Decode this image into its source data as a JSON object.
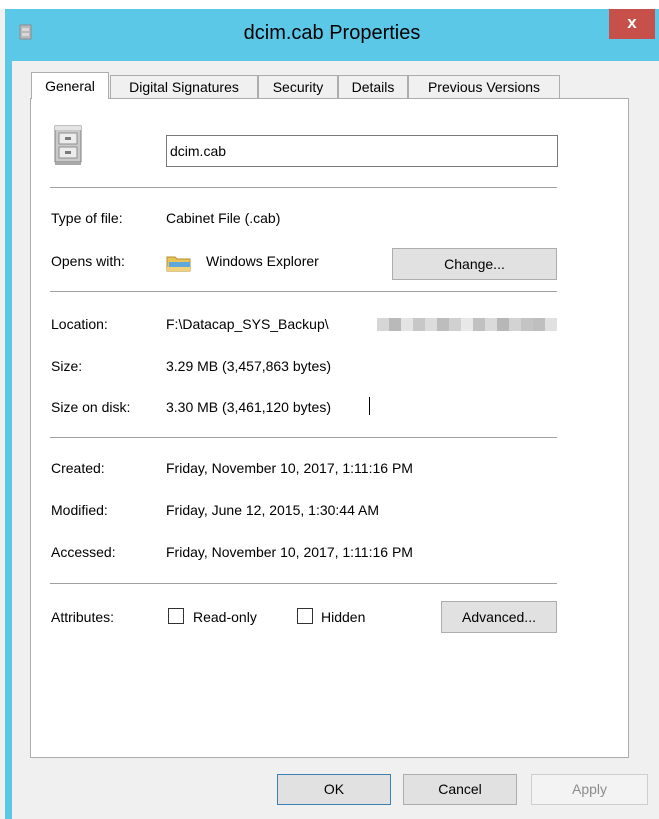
{
  "window": {
    "title": "dcim.cab Properties",
    "close_glyph": "x"
  },
  "tabs": [
    {
      "label": "General",
      "active": true
    },
    {
      "label": "Digital Signatures"
    },
    {
      "label": "Security"
    },
    {
      "label": "Details"
    },
    {
      "label": "Previous Versions"
    }
  ],
  "file": {
    "name": "dcim.cab",
    "icon": "file-cabinet-icon",
    "type_label": "Type of file:",
    "type_value": "Cabinet File (.cab)",
    "opens_label": "Opens with:",
    "opens_value": "Windows Explorer",
    "opens_icon": "folder-icon",
    "change_label": "Change..."
  },
  "location": {
    "location_label": "Location:",
    "location_value": "F:\\Datacap_SYS_Backup\\",
    "size_label": "Size:",
    "size_value": "3.29 MB (3,457,863 bytes)",
    "disk_label": "Size on disk:",
    "disk_value": "3.30 MB (3,461,120 bytes)"
  },
  "dates": {
    "created_label": "Created:",
    "created_value": "Friday, November 10, 2017, 1:11:16 PM",
    "modified_label": "Modified:",
    "modified_value": "Friday, June 12, 2015, 1:30:44 AM",
    "accessed_label": "Accessed:",
    "accessed_value": "Friday, November 10, 2017, 1:11:16 PM"
  },
  "attributes": {
    "label": "Attributes:",
    "readonly_label": "Read-only",
    "readonly_checked": false,
    "hidden_label": "Hidden",
    "hidden_checked": false,
    "advanced_label": "Advanced..."
  },
  "footer": {
    "ok_label": "OK",
    "cancel_label": "Cancel",
    "apply_label": "Apply"
  },
  "colors": {
    "titlebar": "#5cc8e8",
    "close": "#c7504a",
    "panel": "#ffffff",
    "chrome": "#f0f0f0"
  }
}
